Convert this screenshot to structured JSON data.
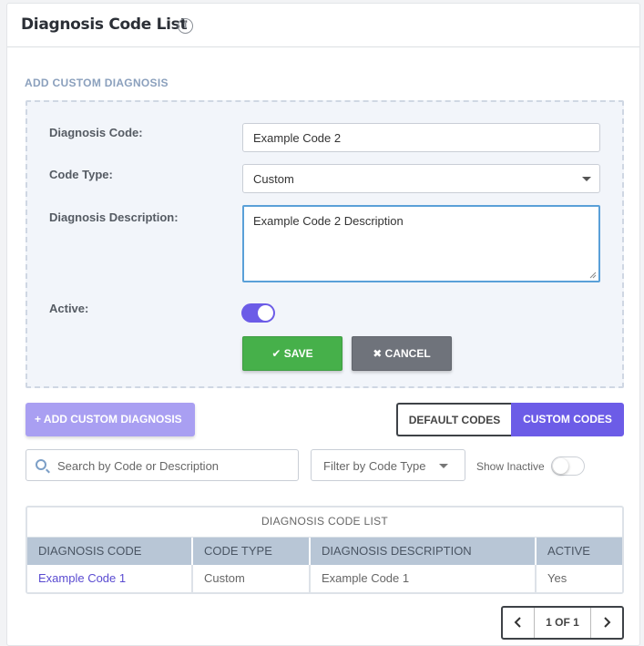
{
  "header": {
    "title": "Diagnosis Code List",
    "info_icon": "info-icon"
  },
  "add_form": {
    "section_label": "ADD CUSTOM DIAGNOSIS",
    "code_label": "Diagnosis Code:",
    "code_value": "Example Code 2",
    "type_label": "Code Type:",
    "type_value": "Custom",
    "desc_label": "Diagnosis Description:",
    "desc_value": "Example Code 2 Description",
    "active_label": "Active:",
    "active_on": true,
    "save_label": "✔ SAVE",
    "cancel_label": "✖ CANCEL",
    "save_color": "#46b04a",
    "cancel_color": "#6f737b"
  },
  "toolbar": {
    "add_label": "+ ADD CUSTOM DIAGNOSIS",
    "default_codes_label": "DEFAULT CODES",
    "custom_codes_label": "CUSTOM CODES",
    "selected_segment": "CUSTOM CODES",
    "accent_color": "#6c5ce7"
  },
  "filters": {
    "search_placeholder": "Search by Code or Description",
    "filter_label": "Filter by Code Type",
    "show_inactive_label": "Show Inactive",
    "show_inactive_on": false
  },
  "table": {
    "caption": "DIAGNOSIS CODE LIST",
    "columns": [
      "DIAGNOSIS CODE",
      "CODE TYPE",
      "DIAGNOSIS DESCRIPTION",
      "ACTIVE"
    ],
    "rows": [
      [
        "Example Code 1",
        "Custom",
        "Example Code 1",
        "Yes"
      ]
    ]
  },
  "pagination": {
    "prev_icon": "chevron-left-icon",
    "label": "1 OF 1",
    "next_icon": "chevron-right-icon"
  }
}
